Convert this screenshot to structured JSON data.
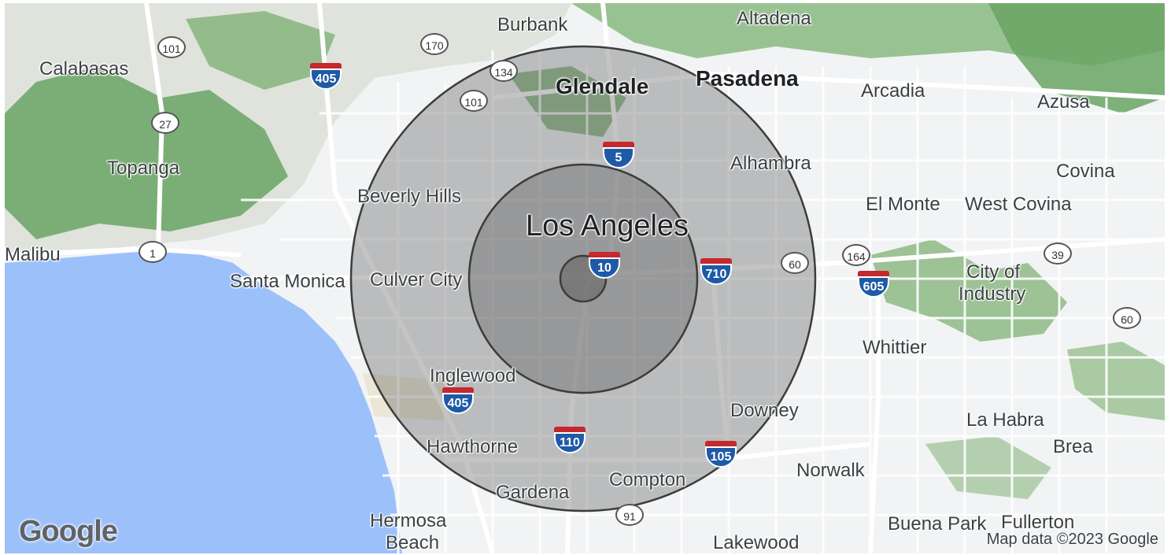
{
  "map": {
    "attribution": "Map data ©2023 Google",
    "logo": "Google",
    "colors": {
      "water": "#9cc0f9",
      "land": "#f1f3f4",
      "park": "#5d9b58",
      "road": "#ffffff",
      "circle_fill": "#555555",
      "circle_stroke": "#3c3c3c"
    },
    "places": {
      "burbank": "Burbank",
      "altadena": "Altadena",
      "calabasas": "Calabasas",
      "glendale": "Glendale",
      "pasadena": "Pasadena",
      "arcadia": "Arcadia",
      "azusa": "Azusa",
      "topanga": "Topanga",
      "alhambra": "Alhambra",
      "covina": "Covina",
      "beverly_hills": "Beverly Hills",
      "el_monte": "El Monte",
      "west_covina": "West Covina",
      "los_angeles": "Los Angeles",
      "malibu": "Malibu",
      "santa_monica": "Santa Monica",
      "culver_city": "Culver City",
      "city_of_industry_1": "City of",
      "city_of_industry_2": "Industry",
      "whittier": "Whittier",
      "inglewood": "Inglewood",
      "downey": "Downey",
      "la_habra": "La Habra",
      "hawthorne": "Hawthorne",
      "brea": "Brea",
      "compton": "Compton",
      "norwalk": "Norwalk",
      "gardena": "Gardena",
      "hermosa_1": "Hermosa",
      "hermosa_2": "Beach",
      "buena_park": "Buena Park",
      "fullerton": "Fullerton",
      "lakewood": "Lakewood"
    },
    "routes": {
      "us101_a": "101",
      "ca170": "170",
      "us134": "134",
      "us101_b": "101",
      "ca27": "27",
      "ca1": "1",
      "ca60_a": "60",
      "ca164": "164",
      "ca39": "39",
      "ca60_b": "60",
      "ca91": "91"
    },
    "interstates": {
      "i405_a": "405",
      "i5": "5",
      "i10": "10",
      "i710": "710",
      "i605": "605",
      "i405_b": "405",
      "i110": "110",
      "i105": "105"
    }
  }
}
